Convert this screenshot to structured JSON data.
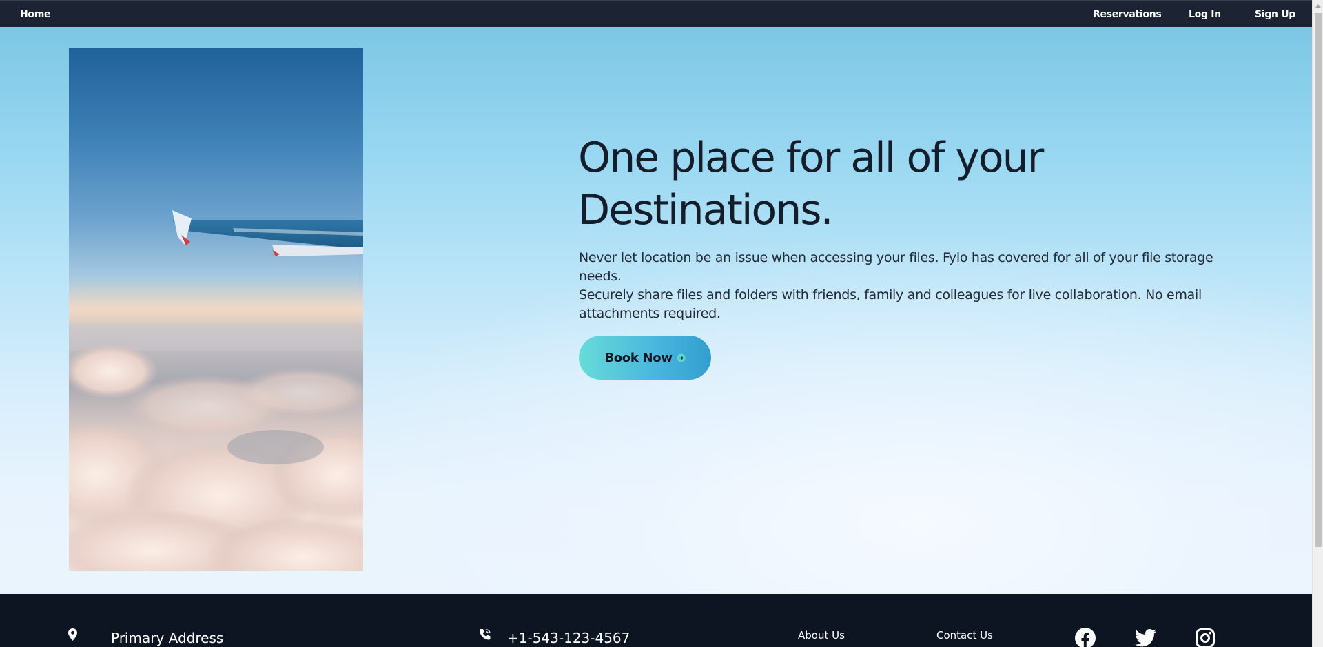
{
  "nav": {
    "home": "Home",
    "reservations": "Reservations",
    "login": "Log In",
    "signup": "Sign Up"
  },
  "hero": {
    "headline_line1": "One place for all of your",
    "headline_line2": "Destinations.",
    "paragraph1": "Never let location be an issue when accessing your files. Fylo has covered for all of your file storage needs.",
    "paragraph2": "Securely share files and folders with friends, family and colleagues for live collaboration. No email attachments required.",
    "cta_label": "Book Now",
    "cta_icon": "arrow-right-circle-icon",
    "image": "airplane-wing-above-clouds"
  },
  "footer": {
    "address_icon": "location-pin-icon",
    "address": "Primary Address",
    "phone_icon": "phone-icon",
    "phone": "+1-543-123-4567",
    "links": [
      "About Us",
      "Contact Us"
    ],
    "social_icons": [
      "facebook-icon",
      "twitter-icon",
      "instagram-icon"
    ]
  },
  "colors": {
    "nav_bg": "#1c2433",
    "footer_bg": "#0d1523",
    "headline": "#151d2b",
    "cta_gradient_start": "#66dcd8",
    "cta_gradient_end": "#339ecf"
  }
}
